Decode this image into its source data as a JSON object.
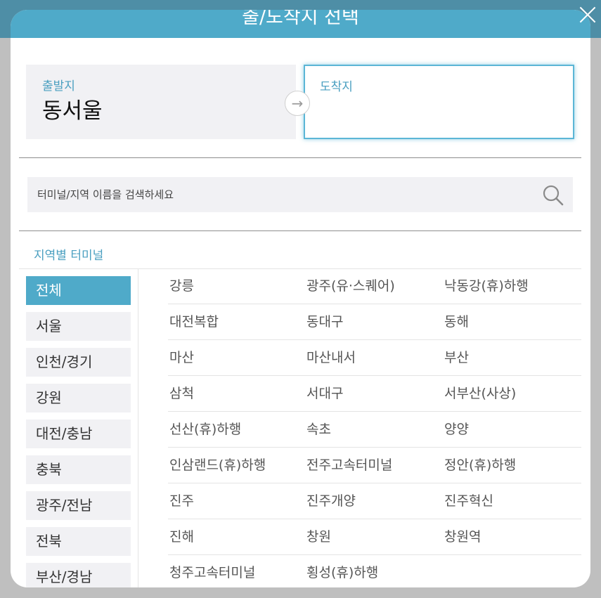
{
  "modal": {
    "title": "출/도착지 선택"
  },
  "departure": {
    "label": "출발지",
    "value": "동서울"
  },
  "arrival": {
    "label": "도착지",
    "value": ""
  },
  "search": {
    "placeholder": "터미널/지역 이름을 검색하세요"
  },
  "section": {
    "title": "지역별 터미널"
  },
  "regions": [
    {
      "label": "전체",
      "selected": true
    },
    {
      "label": "서울",
      "selected": false
    },
    {
      "label": "인천/경기",
      "selected": false
    },
    {
      "label": "강원",
      "selected": false
    },
    {
      "label": "대전/충남",
      "selected": false
    },
    {
      "label": "충북",
      "selected": false
    },
    {
      "label": "광주/전남",
      "selected": false
    },
    {
      "label": "전북",
      "selected": false
    },
    {
      "label": "부산/경남",
      "selected": false
    }
  ],
  "terminals": [
    [
      "강릉",
      "광주(유·스퀘어)",
      "낙동강(휴)하행"
    ],
    [
      "대전복합",
      "동대구",
      "동해"
    ],
    [
      "마산",
      "마산내서",
      "부산"
    ],
    [
      "삼척",
      "서대구",
      "서부산(사상)"
    ],
    [
      "선산(휴)하행",
      "속초",
      "양양"
    ],
    [
      "인삼랜드(휴)하행",
      "전주고속터미널",
      "정안(휴)하행"
    ],
    [
      "진주",
      "진주개양",
      "진주혁신"
    ],
    [
      "진해",
      "창원",
      "창원역"
    ],
    [
      "청주고속터미널",
      "횡성(휴)하행"
    ]
  ],
  "colors": {
    "accent": "#4faac9",
    "accent_text": "#4a9fc0",
    "panel_bg": "#f1f1f4"
  },
  "icons": {
    "close": "close-icon",
    "swap": "arrow-right-icon",
    "search": "search-icon"
  }
}
